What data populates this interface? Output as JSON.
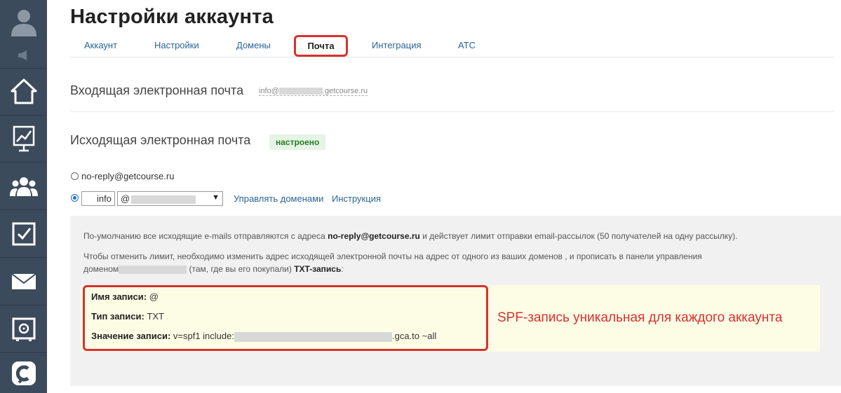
{
  "sidebar": {
    "icons": [
      "user-avatar-icon",
      "megaphone-icon",
      "home-icon",
      "chart-icon",
      "users-icon",
      "checkbox-icon",
      "mail-icon",
      "safe-icon",
      "getcourse-logo-icon"
    ]
  },
  "page": {
    "title": "Настройки аккаунта"
  },
  "tabs": [
    {
      "label": "Аккаунт"
    },
    {
      "label": "Настройки"
    },
    {
      "label": "Домены"
    },
    {
      "label": "Почта",
      "active": true
    },
    {
      "label": "Интеграция"
    },
    {
      "label": "АТС"
    }
  ],
  "incoming": {
    "label": "Входящая электронная почта",
    "email_prefix": "info@",
    "email_suffix": ".getcourse.ru"
  },
  "outgoing": {
    "label": "Исходящая электронная почта",
    "status": "настроено",
    "option_default": "no-reply@getcourse.ru",
    "local_part_value": "info",
    "domain_select_prefix": "@",
    "manage_domains_link": "Управлять доменами",
    "instruction_link": "Инструкция"
  },
  "info": {
    "p1_start": "По-умолчанию все исходящие e-mails отправляются с адреса ",
    "p1_bold": "no-reply@getcourse.ru",
    "p1_end": " и действует лимит отправки email-рассылок (50 получателей на одну рассылку).",
    "p2_line1": "Чтобы отменить лимит, необходимо изменить адрес исходящей электронной почты на адрес от одного из ваших доменов   , и прописать в панели управления",
    "p2_line2_start": "доменом",
    "p2_line2_mid": " (там, где вы его покупали) ",
    "p2_line2_bold": "TXT-запись",
    "p2_line2_end": ":"
  },
  "record": {
    "name_label": "Имя записи:",
    "name_value": " @",
    "type_label": "Тип записи:",
    "type_value": " TXT",
    "value_label": "Значение записи:",
    "value_start": " v=spf1 include:",
    "value_end": ".gca.to ~all"
  },
  "annotation": {
    "text": "SPF-запись уникальная для каждого аккаунта",
    "color": "#d9312e"
  },
  "colors": {
    "sidebar": "#3b4b5c",
    "link": "#2a6496",
    "highlight": "#d9312e",
    "badge_bg": "#e5f4e5",
    "badge_text": "#2a7a2a"
  }
}
